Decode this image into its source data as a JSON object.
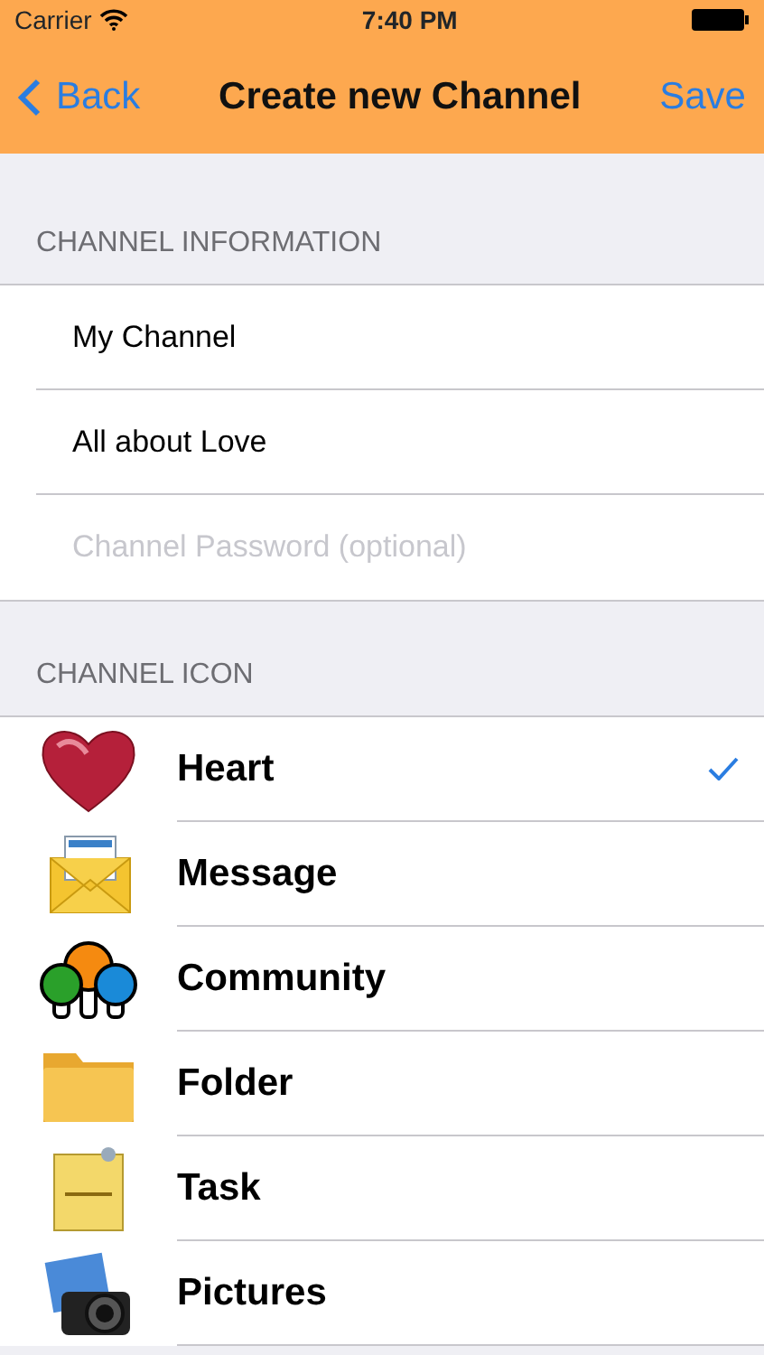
{
  "status_bar": {
    "carrier": "Carrier",
    "time": "7:40 PM"
  },
  "nav_bar": {
    "back": "Back",
    "title": "Create new Channel",
    "action": "Save"
  },
  "sections": [
    {
      "header": "CHANNEL INFORMATION",
      "fields": [
        {
          "value": "My Channel"
        },
        {
          "value": "All about Love"
        },
        {
          "placeholder": "Channel Password (optional)"
        }
      ]
    },
    {
      "header": "CHANNEL ICON",
      "options": [
        {
          "label": "Heart",
          "selected": true
        },
        {
          "label": "Message",
          "selected": false
        },
        {
          "label": "Community",
          "selected": false
        },
        {
          "label": "Folder",
          "selected": false
        },
        {
          "label": "Task",
          "selected": false
        },
        {
          "label": "Pictures",
          "selected": false
        }
      ]
    }
  ]
}
